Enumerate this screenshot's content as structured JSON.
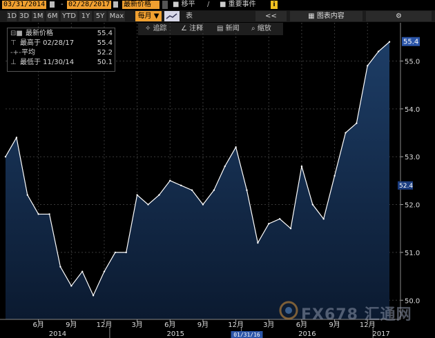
{
  "toolbar": {
    "start_date": "03/31/2014",
    "end_date": "02/28/2017",
    "dash": "-",
    "field": "最新价格",
    "move_label": "移平",
    "events_label": "重要事件",
    "info_label": "i"
  },
  "ranges": [
    "1D",
    "3D",
    "1M",
    "6M",
    "YTD",
    "1Y",
    "5Y",
    "Max"
  ],
  "period": "每月",
  "table_label": "表",
  "collapse_label": "<<",
  "chart_content_label": "图表内容",
  "tools": [
    "追踪",
    "注释",
    "新闻",
    "缩放"
  ],
  "legend": {
    "last_label": "最新价格",
    "last_value": "55.4",
    "high_label": "最高于 02/28/17",
    "high_value": "55.4",
    "avg_label": "平均",
    "avg_value": "52.2",
    "low_label": "最低于 11/30/14",
    "low_value": "50.1"
  },
  "watermark": "FX678 汇通网",
  "crosshair_date": "01/31/16",
  "chart_data": {
    "type": "area",
    "x": [
      "2014-03",
      "2014-04",
      "2014-05",
      "2014-06",
      "2014-07",
      "2014-08",
      "2014-09",
      "2014-10",
      "2014-11",
      "2014-12",
      "2015-01",
      "2015-02",
      "2015-03",
      "2015-04",
      "2015-05",
      "2015-06",
      "2015-07",
      "2015-08",
      "2015-09",
      "2015-10",
      "2015-11",
      "2015-12",
      "2016-01",
      "2016-02",
      "2016-03",
      "2016-04",
      "2016-05",
      "2016-06",
      "2016-07",
      "2016-08",
      "2016-09",
      "2016-10",
      "2016-11",
      "2016-12",
      "2017-01",
      "2017-02"
    ],
    "values": [
      53.0,
      53.4,
      52.2,
      51.8,
      51.8,
      50.7,
      50.3,
      50.6,
      50.1,
      50.6,
      51.0,
      51.0,
      52.2,
      52.0,
      52.2,
      52.5,
      52.4,
      52.3,
      52.0,
      52.3,
      52.8,
      53.2,
      52.3,
      51.2,
      51.6,
      51.7,
      51.5,
      52.8,
      52.0,
      51.7,
      52.6,
      53.5,
      53.7,
      54.9,
      55.2,
      55.4
    ],
    "ylim": [
      49.6,
      55.8
    ],
    "yticks": [
      "50.0",
      "51.0",
      "52.0",
      "53.0",
      "54.0",
      "55.0"
    ],
    "xtick_labels": [
      "6月",
      "9月",
      "12月",
      "3月",
      "6月",
      "9月",
      "12月",
      "3月",
      "6月",
      "9月",
      "12月"
    ],
    "year_labels": [
      "2014",
      "2015",
      "2016",
      "2017"
    ],
    "last_value_label": "55.4",
    "avg_value_label": "52.4",
    "colors": {
      "fill_top": "#1d3d66",
      "fill_bottom": "#0b1a30",
      "line": "#ffffff",
      "background": "#000000"
    }
  }
}
